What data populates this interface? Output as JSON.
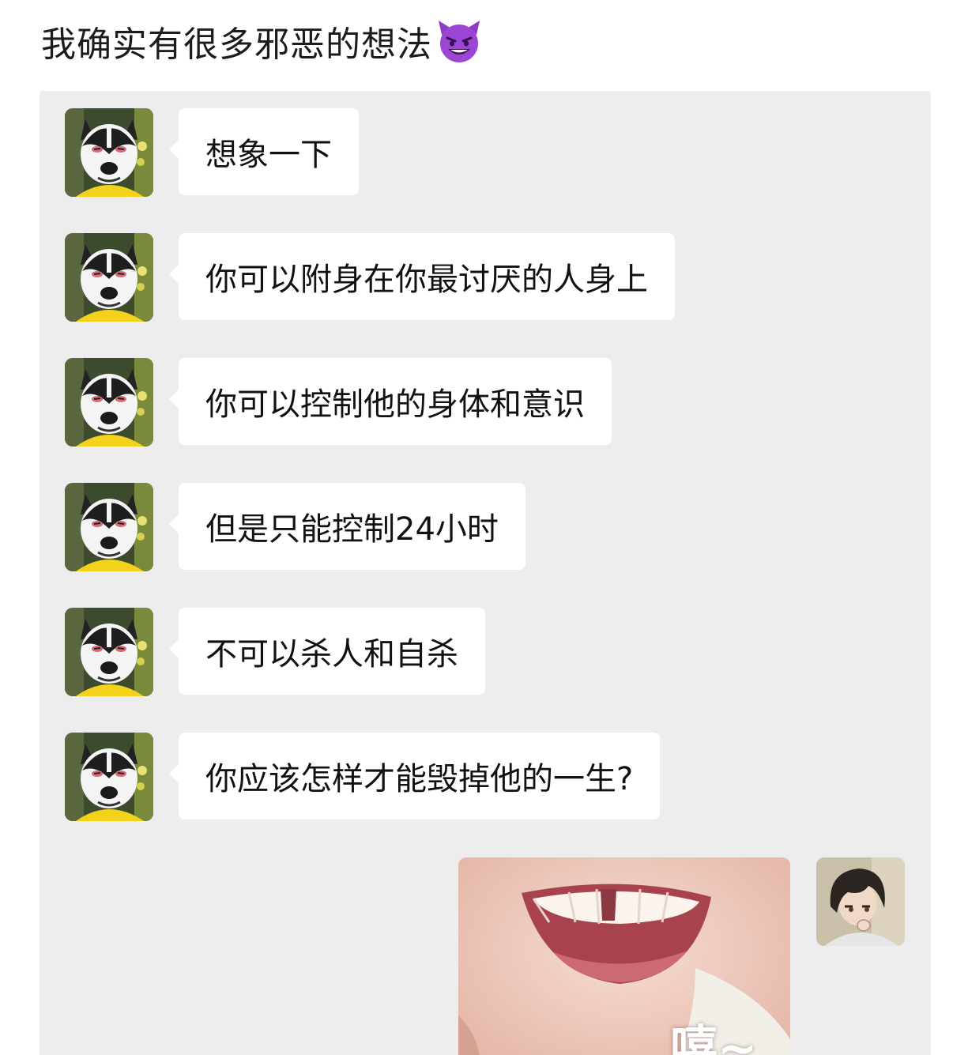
{
  "post": {
    "title": "我确实有很多邪恶的想法",
    "title_emoji_icon": "smiling-devil-emoji"
  },
  "chat": {
    "messages": [
      {
        "sender": "other",
        "avatar_icon": "husky-dog-avatar",
        "text": "想象一下"
      },
      {
        "sender": "other",
        "avatar_icon": "husky-dog-avatar",
        "text": "你可以附身在你最讨厌的人身上"
      },
      {
        "sender": "other",
        "avatar_icon": "husky-dog-avatar",
        "text": "你可以控制他的身体和意识"
      },
      {
        "sender": "other",
        "avatar_icon": "husky-dog-avatar",
        "text": "但是只能控制24小时"
      },
      {
        "sender": "other",
        "avatar_icon": "husky-dog-avatar",
        "text": "不可以杀人和自杀"
      },
      {
        "sender": "other",
        "avatar_icon": "husky-dog-avatar",
        "text": "你应该怎样才能毁掉他的一生?"
      }
    ],
    "reply": {
      "sender": "me",
      "avatar_icon": "anime-boy-avatar",
      "sticker_icon": "smiling-mouth-sticker",
      "sticker_caption": "嘻~"
    }
  },
  "colors": {
    "page_bg": "#ffffff",
    "chat_bg": "#ededed",
    "bubble_bg": "#ffffff",
    "text": "#111111",
    "devil_purple": "#8e3bc7"
  }
}
